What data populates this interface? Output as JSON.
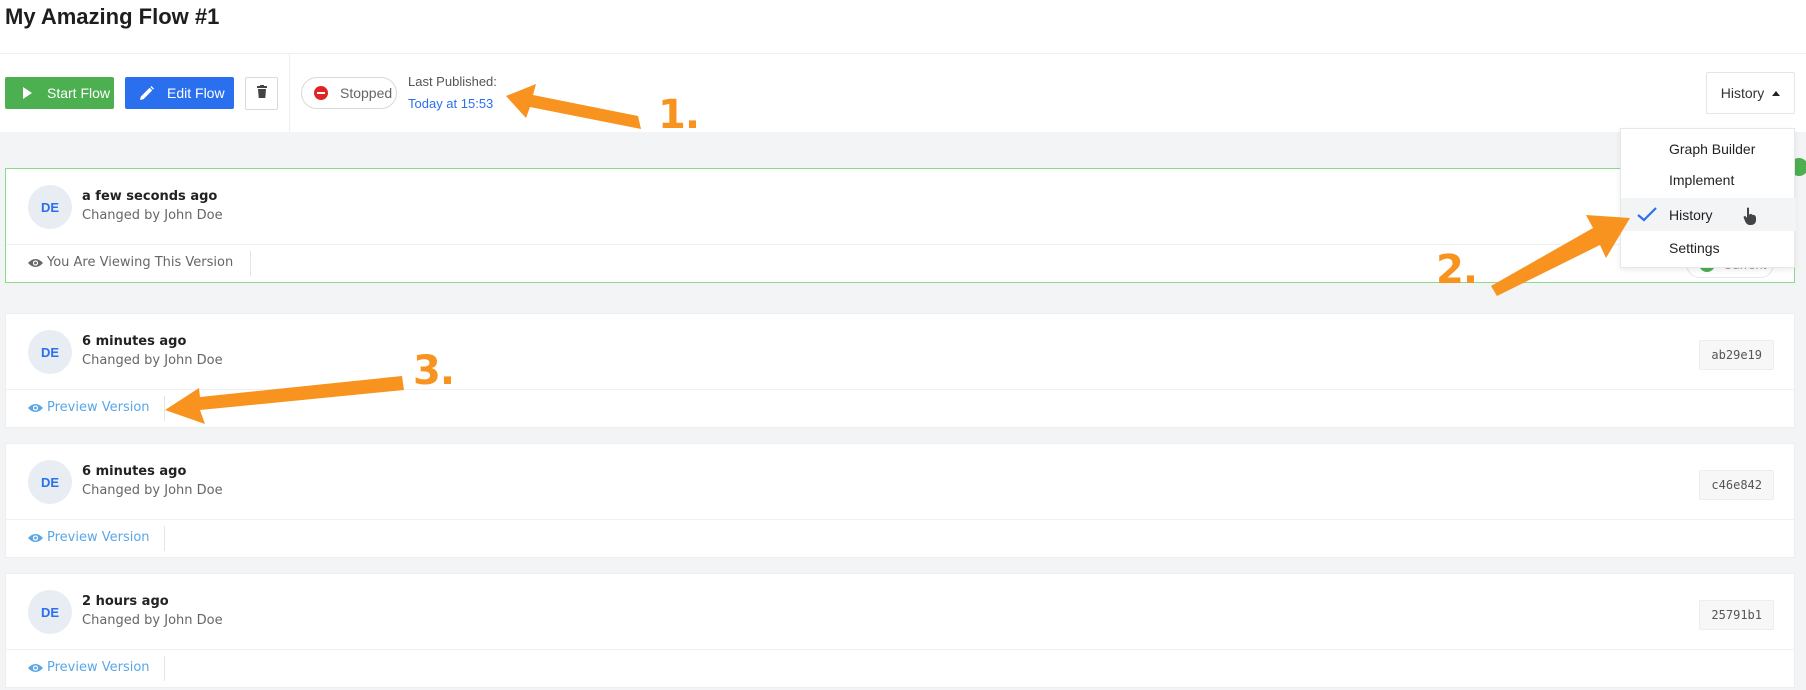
{
  "page": {
    "title": "My Amazing Flow #1"
  },
  "toolbar": {
    "start_label": "Start Flow",
    "edit_label": "Edit Flow",
    "delete_icon": "trash-icon",
    "status": "Stopped",
    "status_color": "#e02424",
    "last_published_label": "Last Published:",
    "last_published_value": "Today at 15:53",
    "view_menu_label": "History"
  },
  "view_menu": {
    "items": [
      {
        "label": "Graph Builder",
        "selected": false
      },
      {
        "label": "Implement",
        "selected": false
      },
      {
        "label": "History",
        "selected": true
      },
      {
        "label": "Settings",
        "selected": false
      }
    ]
  },
  "versions": [
    {
      "avatar": "DE",
      "when": "a few seconds ago",
      "changed_by": "Changed by John Doe",
      "action": "You Are Viewing This Version",
      "badge": "Current",
      "current": true
    },
    {
      "avatar": "DE",
      "when": "6 minutes ago",
      "changed_by": "Changed by John Doe",
      "action": "Preview Version",
      "hash": "ab29e19",
      "current": false
    },
    {
      "avatar": "DE",
      "when": "6 minutes ago",
      "changed_by": "Changed by John Doe",
      "action": "Preview Version",
      "hash": "c46e842",
      "current": false
    },
    {
      "avatar": "DE",
      "when": "2 hours ago",
      "changed_by": "Changed by John Doe",
      "action": "Preview Version",
      "hash": "25791b1",
      "current": false
    }
  ],
  "annotations": {
    "a1": "1.",
    "a2": "2.",
    "a3": "3."
  },
  "colors": {
    "start": "#4caf50",
    "edit": "#2a70ee",
    "link": "#5aa6e6",
    "annotation": "#f7931e",
    "current_border": "#8ada8c"
  }
}
